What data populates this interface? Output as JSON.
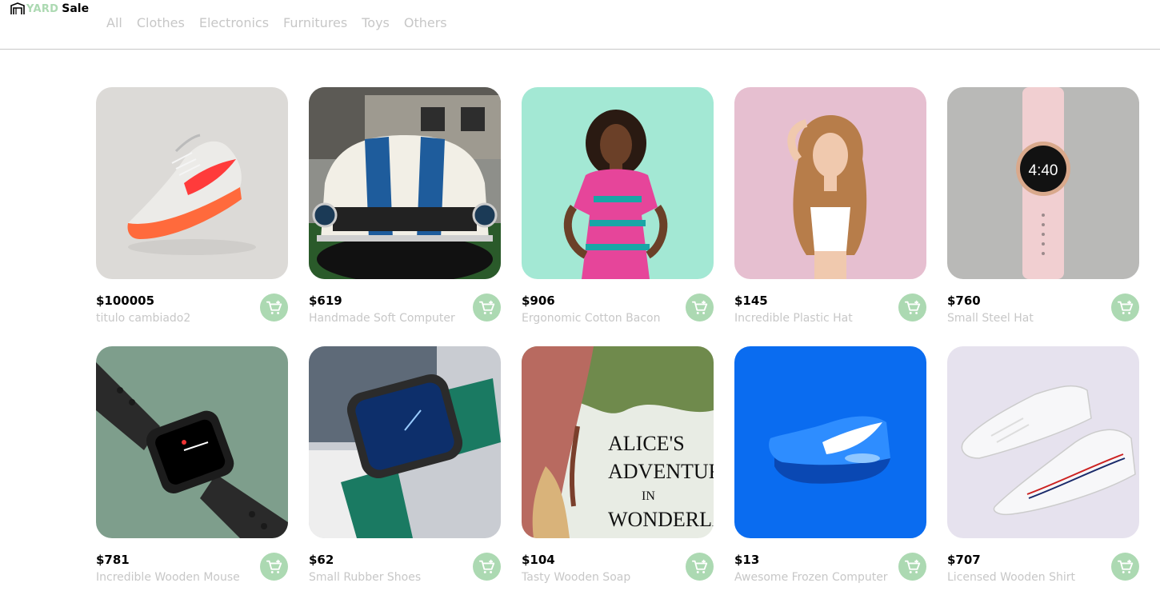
{
  "brand": {
    "yard": "YARD",
    "sale": "Sale"
  },
  "nav": {
    "items": [
      "All",
      "Clothes",
      "Electronics",
      "Furnitures",
      "Toys",
      "Others"
    ]
  },
  "colors": {
    "accent": "#acd9b2",
    "muted_text": "#c7c7c7"
  },
  "products": [
    {
      "price": "$100005",
      "name": "titulo cambiado2",
      "image": "orange-sneaker"
    },
    {
      "price": "$619",
      "name": "Handmade Soft Computer",
      "image": "white-muscle-car"
    },
    {
      "price": "$906",
      "name": "Ergonomic Cotton Bacon",
      "image": "woman-in-dress"
    },
    {
      "price": "$145",
      "name": "Incredible Plastic Hat",
      "image": "woman-curly-hair"
    },
    {
      "price": "$760",
      "name": "Small Steel Hat",
      "image": "pink-smartwatch"
    },
    {
      "price": "$781",
      "name": "Incredible Wooden Mouse",
      "image": "black-smartwatch"
    },
    {
      "price": "$62",
      "name": "Small Rubber Shoes",
      "image": "green-strap-watch"
    },
    {
      "price": "$104",
      "name": "Tasty Wooden Soap",
      "image": "alice-book-cover"
    },
    {
      "price": "$13",
      "name": "Awesome Frozen Computer",
      "image": "blue-sneaker"
    },
    {
      "price": "$707",
      "name": "Licensed Wooden Shirt",
      "image": "white-sneakers"
    }
  ],
  "book_cover_text": [
    "ALICE'S",
    "ADVENTUR",
    "IN",
    "WONDERLA"
  ]
}
